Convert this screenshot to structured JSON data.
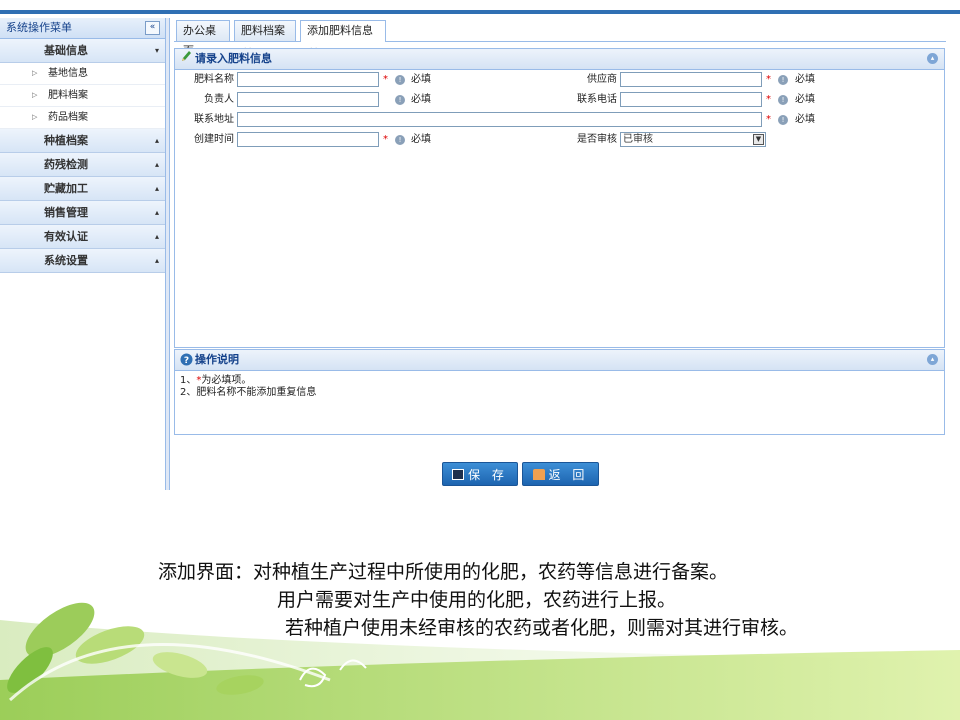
{
  "sidebar": {
    "title": "系统操作菜单",
    "collapse_label": "«",
    "groups": [
      {
        "label": "基础信息",
        "arrow": "▾",
        "items": [
          "基地信息",
          "肥料档案",
          "药品档案"
        ]
      },
      {
        "label": "种植档案",
        "arrow": "▴"
      },
      {
        "label": "药残检测",
        "arrow": "▴"
      },
      {
        "label": "贮藏加工",
        "arrow": "▴"
      },
      {
        "label": "销售管理",
        "arrow": "▴"
      },
      {
        "label": "有效认证",
        "arrow": "▴"
      },
      {
        "label": "系统设置",
        "arrow": "▴"
      }
    ]
  },
  "tabs": [
    {
      "label": "办公桌面",
      "close": ""
    },
    {
      "label": "肥料档案",
      "close": "×"
    },
    {
      "label": "添加肥料信息",
      "close": "×"
    }
  ],
  "form": {
    "title": "请录入肥料信息",
    "required_text": "必填",
    "star": "*",
    "fields": {
      "name": {
        "label": "肥料名称",
        "value": ""
      },
      "supplier": {
        "label": "供应商",
        "value": ""
      },
      "owner": {
        "label": "负责人",
        "value": ""
      },
      "phone": {
        "label": "联系电话",
        "value": ""
      },
      "address": {
        "label": "联系地址",
        "value": ""
      },
      "created": {
        "label": "创建时间",
        "value": ""
      },
      "audited": {
        "label": "是否审核",
        "value": "已审核"
      }
    }
  },
  "notes": {
    "title": "操作说明",
    "line1_prefix": "1、",
    "line1_star": "*",
    "line1_rest": "为必填项。",
    "line2": "2、肥料名称不能添加重复信息"
  },
  "buttons": {
    "save": "保 存",
    "back": "返 回"
  },
  "caption": {
    "line1": "添加界面：对种植生产过程中所使用的化肥，农药等信息进行备案。",
    "line2": "用户需要对生产中使用的化肥，农药进行上报。",
    "line3": "若种植户使用未经审核的农药或者化肥，则需对其进行审核。"
  },
  "colors": {
    "accent": "#2f6fb3",
    "header_text": "#15428b",
    "required_star": "#d00000"
  }
}
